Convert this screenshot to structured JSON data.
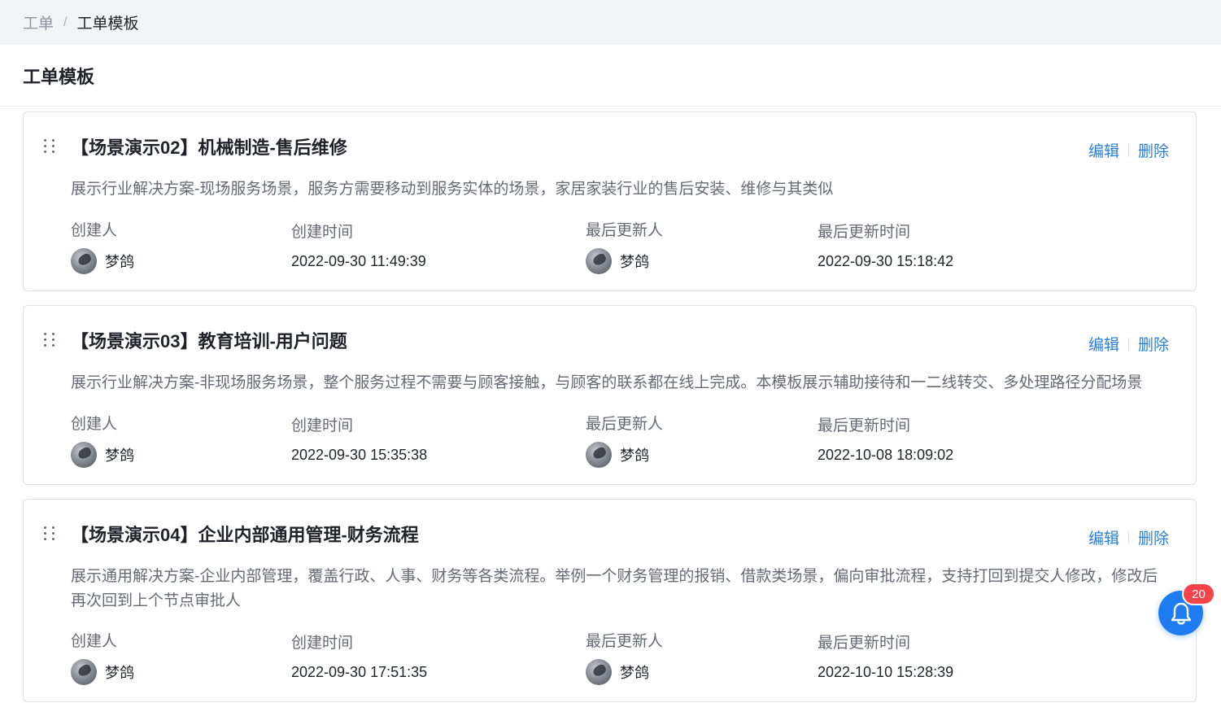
{
  "breadcrumb": {
    "parent": "工单",
    "separator": "/",
    "current": "工单模板"
  },
  "page": {
    "title": "工单模板"
  },
  "labels": {
    "creator": "创建人",
    "created_time": "创建时间",
    "last_updater": "最后更新人",
    "last_updated_time": "最后更新时间",
    "edit": "编辑",
    "delete": "删除"
  },
  "templates": [
    {
      "title": "【场景演示02】机械制造-售后维修",
      "description": "展示行业解决方案-现场服务场景，服务方需要移动到服务实体的场景，家居家装行业的售后安装、维修与其类似",
      "creator": "梦鸽",
      "created_time": "2022-09-30 11:49:39",
      "last_updater": "梦鸽",
      "last_updated_time": "2022-09-30 15:18:42"
    },
    {
      "title": "【场景演示03】教育培训-用户问题",
      "description": "展示行业解决方案-非现场服务场景，整个服务过程不需要与顾客接触，与顾客的联系都在线上完成。本模板展示辅助接待和一二线转交、多处理路径分配场景",
      "creator": "梦鸽",
      "created_time": "2022-09-30 15:35:38",
      "last_updater": "梦鸽",
      "last_updated_time": "2022-10-08 18:09:02"
    },
    {
      "title": "【场景演示04】企业内部通用管理-财务流程",
      "description": "展示通用解决方案-企业内部管理，覆盖行政、人事、财务等各类流程。举例一个财务管理的报销、借款类场景，偏向审批流程，支持打回到提交人修改，修改后再次回到上个节点审批人",
      "creator": "梦鸽",
      "created_time": "2022-09-30 17:51:35",
      "last_updater": "梦鸽",
      "last_updated_time": "2022-10-10 15:28:39"
    }
  ],
  "notification": {
    "icon": "bell-icon",
    "count": "20"
  },
  "colors": {
    "accent": "#2b7fd6",
    "badge": "#f5434a",
    "bell": "#1f7cf0"
  }
}
